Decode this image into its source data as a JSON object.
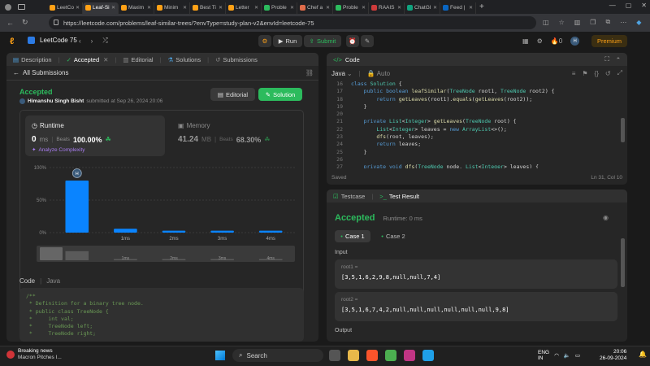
{
  "browser": {
    "tabs": [
      {
        "label": "LeetCo",
        "color": "#ffa116"
      },
      {
        "label": "Leaf-Si",
        "color": "#ffa116",
        "active": true
      },
      {
        "label": "Maxim",
        "color": "#ffa116"
      },
      {
        "label": "Minim",
        "color": "#ffa116"
      },
      {
        "label": "Best Ti",
        "color": "#ffa116"
      },
      {
        "label": "Letter",
        "color": "#ffa116"
      },
      {
        "label": "Proble",
        "color": "#2cbb5d"
      },
      {
        "label": "Chef a",
        "color": "#e06c4a"
      },
      {
        "label": "Proble",
        "color": "#2cbb5d"
      },
      {
        "label": "RAAIS",
        "color": "#ce3b3b"
      },
      {
        "label": "ChatGI",
        "color": "#10a37f"
      },
      {
        "label": "Feed |",
        "color": "#0a66c2"
      }
    ],
    "url": "https://leetcode.com/problems/leaf-similar-trees/?envType=study-plan-v2&envId=leetcode-75"
  },
  "lc": {
    "study_plan": "LeetCode 75",
    "run": "Run",
    "submit": "Submit",
    "fire_count": "0",
    "avatar": "H",
    "premium": "Premium"
  },
  "left_tabs": [
    "Description",
    "Accepted",
    "Editorial",
    "Solutions",
    "Submissions"
  ],
  "submission": {
    "back_link": "All Submissions",
    "status": "Accepted",
    "user": "Himanshu Singh Bisht",
    "submitted_text": "submitted at Sep 26, 2024 20:06",
    "editorial_btn": "Editorial",
    "solution_btn": "Solution",
    "runtime_label": "Runtime",
    "runtime_value": "0",
    "runtime_unit": "ms",
    "beats_label": "Beats",
    "runtime_beats": "100.00%",
    "analyze": "Analyze Complexity",
    "memory_label": "Memory",
    "memory_value": "41.24",
    "memory_unit": "MB",
    "memory_beats": "68.30%",
    "code_label": "Code",
    "code_lang": "Java"
  },
  "chart_data": {
    "type": "bar",
    "categories": [
      "",
      "1ms",
      "2ms",
      "3ms",
      "4ms"
    ],
    "values": [
      80,
      6,
      3,
      3,
      3
    ],
    "ylim": [
      0,
      100
    ],
    "yticks": [
      "100%",
      "50%",
      "0%"
    ],
    "marker": "H",
    "color": "#0a84ff"
  },
  "left_code": [
    "/**",
    " * Definition for a binary tree node.",
    " * public class TreeNode {",
    " *     int val;",
    " *     TreeNode left;",
    " *     TreeNode right;"
  ],
  "editor": {
    "title": "Code",
    "lang": "Java",
    "auto": "Auto",
    "saved": "Saved",
    "cursor": "Ln 31, Col 10",
    "line_numbers": [
      "16",
      "17",
      "18",
      "19",
      "20",
      "21",
      "22",
      "23",
      "24",
      "25",
      "26",
      "27"
    ],
    "lines": [
      "class Solution {",
      "    public boolean leafSimilar(TreeNode root1, TreeNode root2) {",
      "        return getLeaves(root1).equals(getLeaves(root2));",
      "    }",
      "",
      "    private List<Integer> getLeaves(TreeNode root) {",
      "        List<Integer> leaves = new ArrayList<>();",
      "        dfs(root, leaves);",
      "        return leaves;",
      "    }",
      "",
      "    private void dfs(TreeNode node, List<Integer> leaves) {"
    ]
  },
  "result": {
    "tab_testcase": "Testcase",
    "tab_result": "Test Result",
    "status": "Accepted",
    "runtime": "Runtime: 0 ms",
    "case1": "Case 1",
    "case2": "Case 2",
    "input_label": "Input",
    "root1_label": "root1 =",
    "root1_value": "[3,5,1,6,2,9,8,null,null,7,4]",
    "root2_label": "root2 =",
    "root2_value": "[3,5,1,6,7,4,2,null,null,null,null,null,null,9,8]",
    "output_label": "Output"
  },
  "taskbar": {
    "news_title": "Breaking news",
    "news_sub": "Macron Pitches I...",
    "search": "Search",
    "lang1": "ENG",
    "lang2": "IN",
    "time": "20:06",
    "date": "26-09-2024"
  }
}
